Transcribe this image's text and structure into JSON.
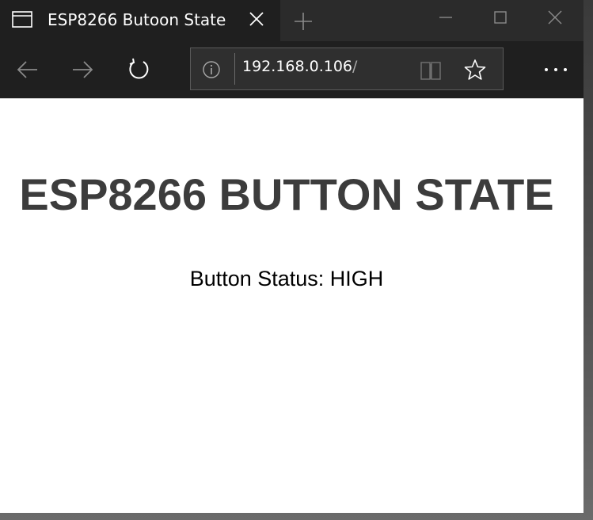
{
  "browser": {
    "tab": {
      "title": "ESP8266 Butoon State"
    },
    "address_bar": {
      "url_main": "192.168.0.106",
      "url_trail": "/"
    },
    "icons": {
      "tab_page": "tab-page-icon",
      "close_tab": "close-icon",
      "new_tab": "plus-icon",
      "minimize": "minimize-icon",
      "maximize": "maximize-icon",
      "close_window": "close-icon",
      "back": "arrow-left-icon",
      "forward": "arrow-right-icon",
      "refresh": "refresh-icon",
      "site_info": "info-icon",
      "reading_view": "book-icon",
      "favorite": "star-icon",
      "more": "ellipsis-icon"
    },
    "colors": {
      "chrome_dark": "#1f1f1f",
      "tab_strip": "#2b2b2b",
      "icon_dim": "#8a8a8a"
    }
  },
  "page": {
    "heading": "ESP8266 BUTTON STATE",
    "status_label": "Button Status: ",
    "status_value": "HIGH",
    "colors": {
      "heading": "#3c3c3c",
      "text": "#000000",
      "background": "#ffffff"
    }
  }
}
